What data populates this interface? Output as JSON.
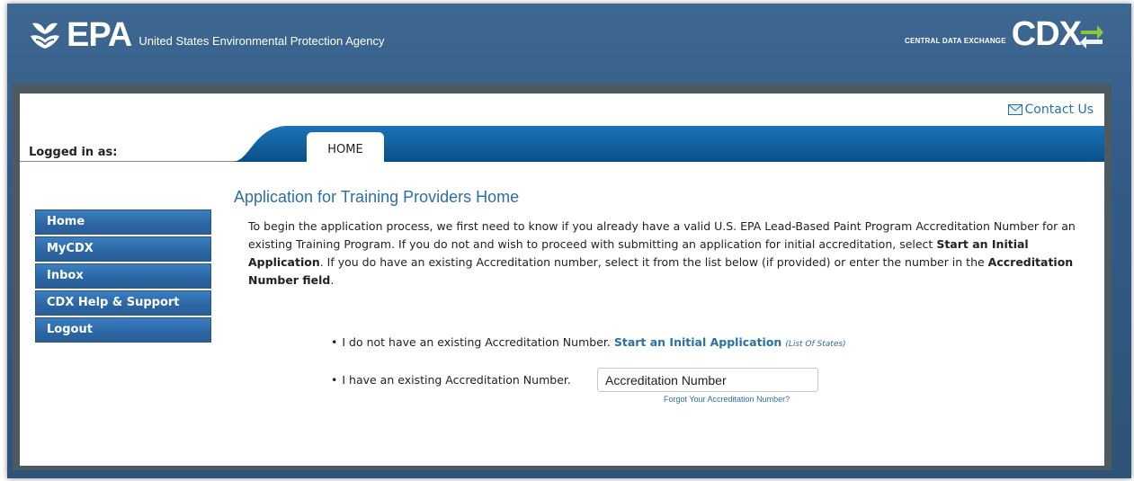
{
  "header": {
    "logo_text": "EPA",
    "agency_name": "United States Environmental Protection Agency",
    "cdx_small": "CENTRAL DATA EXCHANGE",
    "cdx_logo": "CDX"
  },
  "toolbar": {
    "contact_label": "Contact Us"
  },
  "nav": {
    "logged_in_label": "Logged in as:",
    "tabs": [
      {
        "label": "HOME"
      }
    ]
  },
  "sidebar": {
    "items": [
      {
        "label": "Home"
      },
      {
        "label": "MyCDX"
      },
      {
        "label": "Inbox"
      },
      {
        "label": "CDX Help & Support"
      },
      {
        "label": "Logout"
      }
    ]
  },
  "main": {
    "title": "Application for Training Providers Home",
    "intro": {
      "p1": "To begin the application process, we first need to know if you already have a valid U.S. EPA Lead-Based Paint Program Accreditation Number for an existing Training Program. If you do not and wish to proceed with submitting an application for initial accreditation, select ",
      "b1": "Start an Initial Application",
      "p2": ". If you do have an existing Accreditation number, select it from the list below (if provided) or enter the number in the ",
      "b2": "Accreditation Number field",
      "p3": "."
    },
    "option1": {
      "text": "I do not have an existing Accreditation Number.",
      "link": "Start an Initial Application",
      "sublink": "(List Of States)"
    },
    "option2": {
      "text": "I have an existing Accreditation Number.",
      "input_value": "Accreditation Number",
      "forgot_link": "Forgot Your Accreditation Number?"
    }
  },
  "colors": {
    "header_blue": "#3e6891",
    "nav_blue": "#0b5a96",
    "link_blue": "#2a70a6",
    "sidebar_blue": "#2b65a3"
  }
}
